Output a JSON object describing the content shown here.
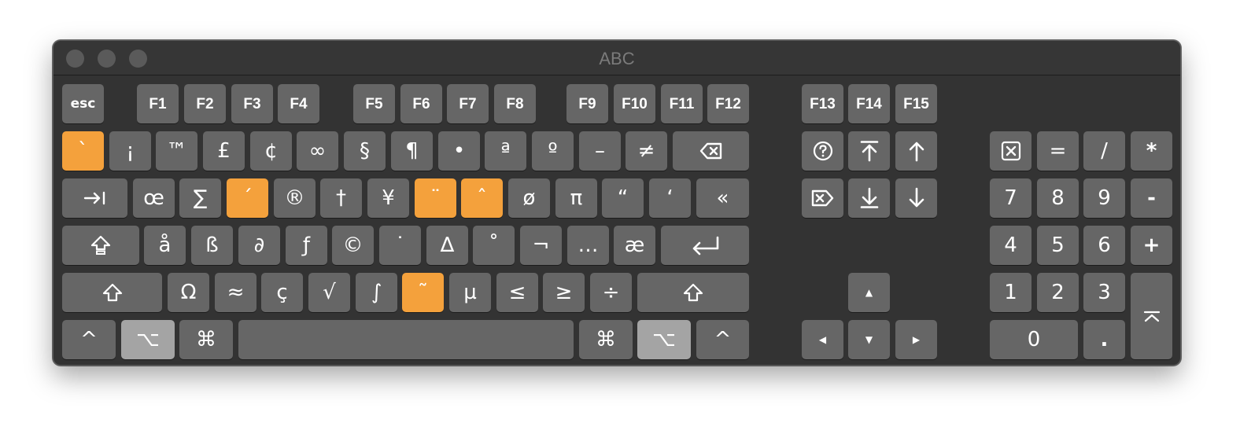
{
  "window": {
    "title": "ABC"
  },
  "colors": {
    "key": "#666666",
    "dead_key": "#f4a13c",
    "pressed_key": "#a4a4a4",
    "background": "#333333"
  },
  "function_row": {
    "esc": "esc",
    "f1": "F1",
    "f2": "F2",
    "f3": "F3",
    "f4": "F4",
    "f5": "F5",
    "f6": "F6",
    "f7": "F7",
    "f8": "F8",
    "f9": "F9",
    "f10": "F10",
    "f11": "F11",
    "f12": "F12",
    "f13": "F13",
    "f14": "F14",
    "f15": "F15"
  },
  "number_row": [
    "`",
    "¡",
    "™",
    "£",
    "¢",
    "∞",
    "§",
    "¶",
    "•",
    "ª",
    "º",
    "–",
    "≠"
  ],
  "qwerty_row": [
    "œ",
    "∑",
    "´",
    "®",
    "†",
    "¥",
    "¨",
    "ˆ",
    "ø",
    "π",
    "“",
    "‘",
    "«"
  ],
  "home_row": [
    "å",
    "ß",
    "∂",
    "ƒ",
    "©",
    "˙",
    "∆",
    "˚",
    "¬",
    "…",
    "æ"
  ],
  "bottom_row": [
    "Ω",
    "≈",
    "ç",
    "√",
    "∫",
    "˜",
    "µ",
    "≤",
    "≥",
    "÷"
  ],
  "modifiers": {
    "control": "^",
    "option": "⌥",
    "command": "⌘"
  },
  "arrows": {
    "up": "▲",
    "left": "◀",
    "down": "▼",
    "right": "▶"
  },
  "numpad": {
    "equals": "=",
    "divide": "/",
    "multiply": "*",
    "seven": "7",
    "eight": "8",
    "nine": "9",
    "minus": "-",
    "four": "4",
    "five": "5",
    "six": "6",
    "plus": "+",
    "one": "1",
    "two": "2",
    "three": "3",
    "zero": "0",
    "decimal": "."
  },
  "icons": [
    "delete-left-icon",
    "tab-icon",
    "caps-lock-icon",
    "return-icon",
    "shift-icon",
    "help-icon",
    "home-icon",
    "page-up-icon",
    "delete-forward-icon",
    "end-icon",
    "page-down-icon",
    "clear-icon",
    "enter-icon"
  ]
}
